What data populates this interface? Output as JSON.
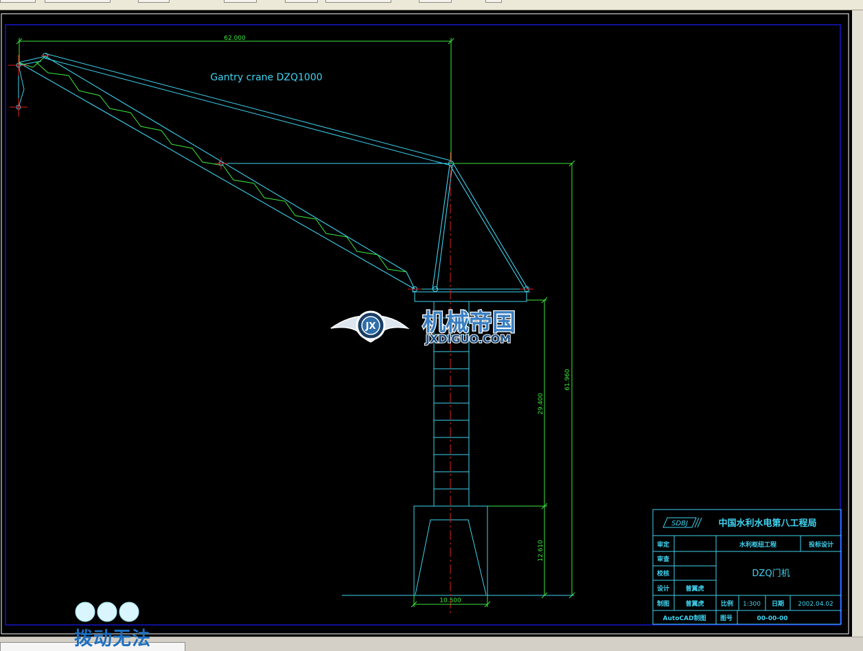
{
  "drawing": {
    "title": "Gantry crane DZQ1000",
    "dimensions": {
      "boom_reach": "62.000",
      "total_height": "61.960",
      "tower_height": "29.400",
      "portal_height": "12.610",
      "portal_width": "10.500"
    }
  },
  "title_block": {
    "logo": "SDBJ",
    "company": "中国水利水电第八工程局",
    "rows": {
      "approve_label": "审定",
      "review_label": "审查",
      "check_label": "校核",
      "design_label": "设计",
      "designer": "曾翼虎",
      "draw_label": "制图",
      "drafter": "曾翼虎",
      "software": "AutoCAD制图"
    },
    "project": "水利枢纽工程",
    "stage": "投标设计",
    "drawing_name": "DZQ门机",
    "scale_label": "比例",
    "scale": "1:300",
    "date_label": "日期",
    "date": "2002.04.02",
    "number_label": "图号",
    "number": "00-00-00"
  },
  "watermarks": {
    "site_name": "机械帝国",
    "site_url": "JXDIGUO.COM",
    "site_badge": "JX",
    "overlay_text": "拨动无法"
  },
  "colors": {
    "background": "#000000",
    "cyan": "#3fd3f0",
    "green": "#3ee83e",
    "red": "#e02020",
    "blue": "#1a1aff",
    "watermark_blue": "#1e6fc0"
  }
}
